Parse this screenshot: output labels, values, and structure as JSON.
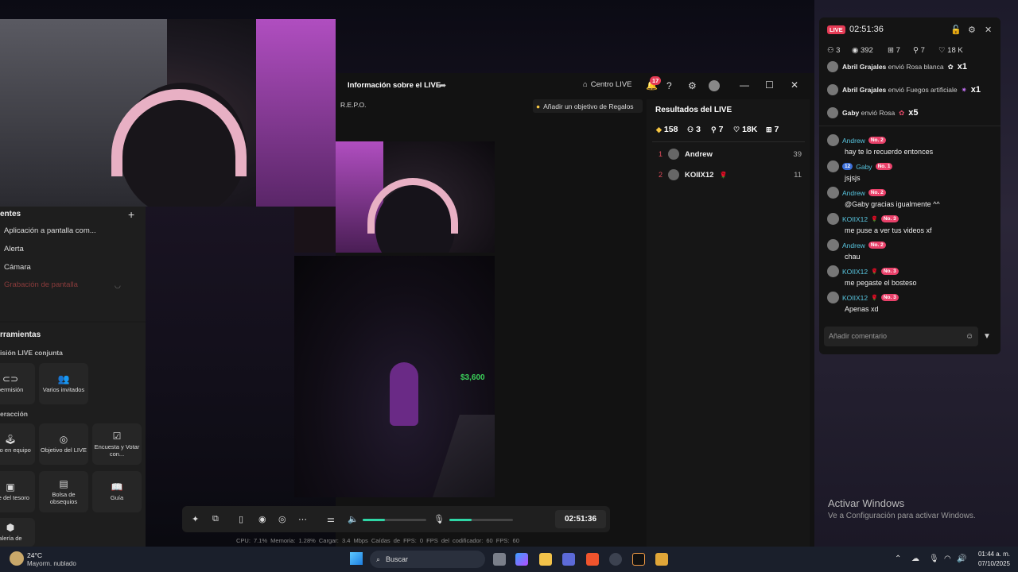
{
  "desktop": {
    "activate_title": "Activar Windows",
    "activate_sub": "Ve a Configuración para activar Windows."
  },
  "studio": {
    "sources_title": "entes",
    "sources_add": "+",
    "sources": [
      "Aplicación a pantalla com...",
      "Alerta",
      "Cámara",
      "Grabación de pantalla"
    ],
    "tools_title": "rramientas",
    "joint_live_title": "isión LIVE conjunta",
    "joint_tools": [
      {
        "icon": "link-icon",
        "label": "permisión"
      },
      {
        "icon": "guests-icon",
        "label": "Varios invitados"
      }
    ],
    "interaction_title": "eracción",
    "interaction_tools": [
      {
        "icon": "joystick-icon",
        "label": "uego en equipo"
      },
      {
        "icon": "target-icon",
        "label": "Objetivo del LIVE"
      },
      {
        "icon": "poll-icon",
        "label": "Encuesta y Votar con..."
      },
      {
        "icon": "chest-icon",
        "label": "ofre del tesoro"
      },
      {
        "icon": "gift-bag-icon",
        "label": "Bolsa de obsequios"
      },
      {
        "icon": "guide-icon",
        "label": "Guía"
      },
      {
        "icon": "gallery-icon",
        "label": "alería de"
      }
    ]
  },
  "main": {
    "title": "Información sobre el LIVE",
    "centro_live": "Centro LIVE",
    "notif_count": "17",
    "game_tag": "R.E.P.O.",
    "goal_button": "Añadir un objetivo de Regalos",
    "money_overlay": "$3,600"
  },
  "results": {
    "title": "Resultados del LIVE",
    "stats": [
      {
        "icon": "diamond-icon",
        "value": "158"
      },
      {
        "icon": "viewers-icon",
        "value": "3"
      },
      {
        "icon": "follow-icon",
        "value": "7"
      },
      {
        "icon": "heart-icon",
        "value": "18K"
      },
      {
        "icon": "gift-icon",
        "value": "7"
      }
    ],
    "ranking": [
      {
        "rank": "1",
        "name": "Andrew",
        "score": "39"
      },
      {
        "rank": "2",
        "name": "KOIIX12",
        "score": "11"
      }
    ]
  },
  "controls": {
    "timer": "02:51:36",
    "volume_level": 0.35,
    "mic_level": 0.35,
    "stats": "CPU: 7.1%   Memoria: 1.28%   Cargar: 3.4 Mbps   Caídas de FPS: 0   FPS del codificador: 60   FPS: 60"
  },
  "chat": {
    "live_label": "LIVE",
    "timer": "02:51:36",
    "stats": [
      {
        "icon": "viewers-icon",
        "value": "3"
      },
      {
        "icon": "eye-icon",
        "value": "392"
      },
      {
        "icon": "gift-icon",
        "value": "7"
      },
      {
        "icon": "follow-icon",
        "value": "7"
      },
      {
        "icon": "heart-icon",
        "value": "18 K"
      }
    ],
    "gifts": [
      {
        "user": "Abril Grajales",
        "text": "envió Rosa blanca",
        "mult": "x1"
      },
      {
        "user": "Abril Grajales",
        "text": "envió Fuegos artificiale",
        "mult": "x1"
      },
      {
        "user": "Gaby",
        "text": "envió Rosa",
        "mult": "x5"
      }
    ],
    "messages": [
      {
        "name": "Andrew",
        "badge": "No. 2",
        "level": "",
        "text": "hay te lo recuerdo entonces"
      },
      {
        "name": "Gaby",
        "badge": "No. 1",
        "level": "12",
        "text": "jsjsjs"
      },
      {
        "name": "Andrew",
        "badge": "No. 2",
        "level": "",
        "text": "@Gaby gracias igualmente ^^"
      },
      {
        "name": "KOIIX12",
        "badge": "No. 3",
        "level": "",
        "text": "me puse a ver tus videos xf"
      },
      {
        "name": "Andrew",
        "badge": "No. 2",
        "level": "",
        "text": "chau"
      },
      {
        "name": "KOIIX12",
        "badge": "No. 3",
        "level": "",
        "text": "me pegaste el bosteso"
      },
      {
        "name": "KOIIX12",
        "badge": "No. 3",
        "level": "",
        "text": "Apenas xd"
      }
    ],
    "input_placeholder": "Añadir comentario"
  },
  "taskbar": {
    "weather_temp": "24°C",
    "weather_desc": "Mayorm. nublado",
    "search_label": "Buscar",
    "time": "01:44 a. m.",
    "date": "07/10/2025"
  }
}
